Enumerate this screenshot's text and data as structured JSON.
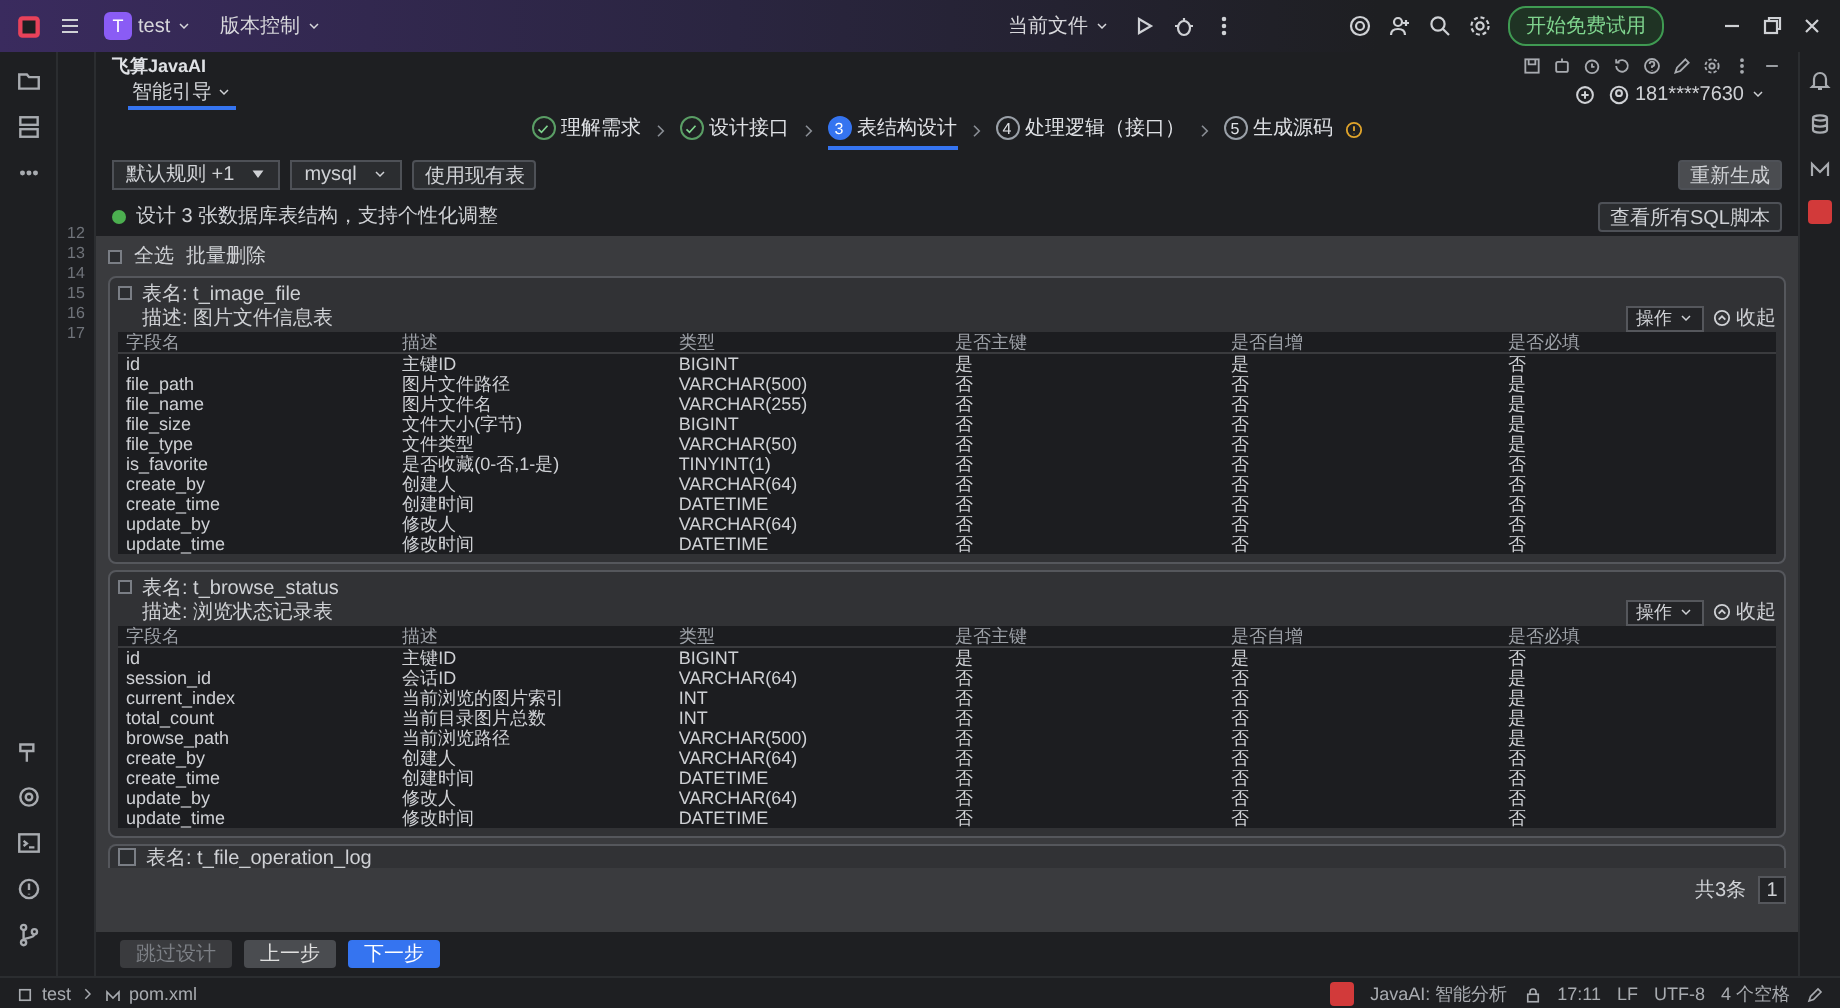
{
  "title_bar": {
    "project_badge": "T",
    "project": "test",
    "vcs": "版本控制",
    "run_config": "当前文件",
    "trial_button": "开始免费试用"
  },
  "gutter": {
    "line_numbers": [
      "12",
      "13",
      "14",
      "15",
      "16",
      "17"
    ]
  },
  "tool_window": {
    "title": "飞算JavaAI",
    "mode_tab": "智能引导",
    "account": "181****7630"
  },
  "steps": [
    {
      "label": "理解需求",
      "kind": "done"
    },
    {
      "label": "设计接口",
      "kind": "done"
    },
    {
      "label": "表结构设计",
      "kind": "current",
      "number": "3"
    },
    {
      "label": "处理逻辑（接口）",
      "kind": "todo",
      "number": "4"
    },
    {
      "label": "生成源码",
      "kind": "todo",
      "number": "5"
    }
  ],
  "options": {
    "rule_select": "默认规则 +1",
    "db_select": "mysql",
    "use_existing_button": "使用现有表",
    "regenerate_button": "重新生成"
  },
  "summary": {
    "text": "设计 3 张数据库表结构，支持个性化调整",
    "view_sql_button": "查看所有SQL脚本"
  },
  "bulk": {
    "select_all": "全选",
    "select_all_checked": false,
    "batch_delete": "批量删除"
  },
  "tables": [
    {
      "name_label": "表名: t_image_file",
      "desc_label": "描述: 图片文件信息表",
      "checked": false,
      "action_button": "操作",
      "collapse_button": "收起",
      "columns": [
        "字段名",
        "描述",
        "类型",
        "是否主键",
        "是否自增",
        "是否必填"
      ],
      "rows": [
        [
          "id",
          "主键ID",
          "BIGINT",
          "是",
          "是",
          "否"
        ],
        [
          "file_path",
          "图片文件路径",
          "VARCHAR(500)",
          "否",
          "否",
          "是"
        ],
        [
          "file_name",
          "图片文件名",
          "VARCHAR(255)",
          "否",
          "否",
          "是"
        ],
        [
          "file_size",
          "文件大小(字节)",
          "BIGINT",
          "否",
          "否",
          "是"
        ],
        [
          "file_type",
          "文件类型",
          "VARCHAR(50)",
          "否",
          "否",
          "是"
        ],
        [
          "is_favorite",
          "是否收藏(0-否,1-是)",
          "TINYINT(1)",
          "否",
          "否",
          "否"
        ],
        [
          "create_by",
          "创建人",
          "VARCHAR(64)",
          "否",
          "否",
          "否"
        ],
        [
          "create_time",
          "创建时间",
          "DATETIME",
          "否",
          "否",
          "否"
        ],
        [
          "update_by",
          "修改人",
          "VARCHAR(64)",
          "否",
          "否",
          "否"
        ],
        [
          "update_time",
          "修改时间",
          "DATETIME",
          "否",
          "否",
          "否"
        ]
      ]
    },
    {
      "name_label": "表名: t_browse_status",
      "desc_label": "描述: 浏览状态记录表",
      "checked": false,
      "action_button": "操作",
      "collapse_button": "收起",
      "columns": [
        "字段名",
        "描述",
        "类型",
        "是否主键",
        "是否自增",
        "是否必填"
      ],
      "rows": [
        [
          "id",
          "主键ID",
          "BIGINT",
          "是",
          "是",
          "否"
        ],
        [
          "session_id",
          "会话ID",
          "VARCHAR(64)",
          "否",
          "否",
          "是"
        ],
        [
          "current_index",
          "当前浏览的图片索引",
          "INT",
          "否",
          "否",
          "是"
        ],
        [
          "total_count",
          "当前目录图片总数",
          "INT",
          "否",
          "否",
          "是"
        ],
        [
          "browse_path",
          "当前浏览路径",
          "VARCHAR(500)",
          "否",
          "否",
          "是"
        ],
        [
          "create_by",
          "创建人",
          "VARCHAR(64)",
          "否",
          "否",
          "否"
        ],
        [
          "create_time",
          "创建时间",
          "DATETIME",
          "否",
          "否",
          "否"
        ],
        [
          "update_by",
          "修改人",
          "VARCHAR(64)",
          "否",
          "否",
          "否"
        ],
        [
          "update_time",
          "修改时间",
          "DATETIME",
          "否",
          "否",
          "否"
        ]
      ]
    }
  ],
  "partial_table": {
    "name_label": "表名: t_file_operation_log",
    "checked": false
  },
  "pagination": {
    "total": "共3条",
    "page": "1"
  },
  "footer": [
    {
      "label": "跳过设计",
      "kind": "disabled"
    },
    {
      "label": "上一步",
      "kind": "secondary"
    },
    {
      "label": "下一步",
      "kind": "primary"
    }
  ],
  "status_bar": {
    "breadcrumb": [
      "test",
      "pom.xml"
    ],
    "plugin": "JavaAI: 智能分析",
    "position": "17:11",
    "line_ending": "LF",
    "encoding": "UTF-8",
    "indent": "4 个空格"
  }
}
